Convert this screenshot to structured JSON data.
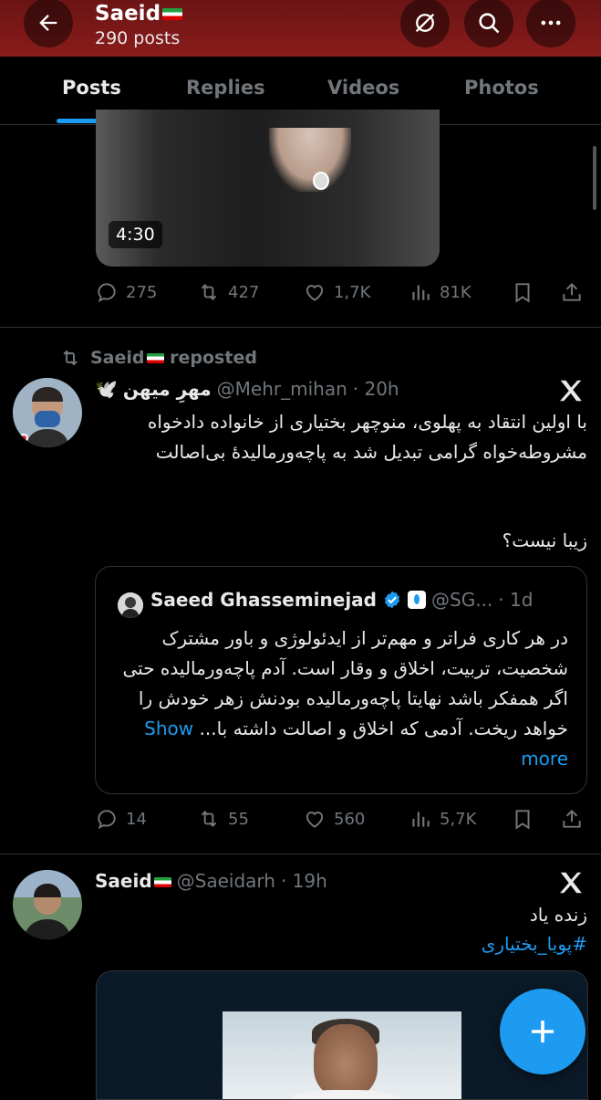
{
  "header": {
    "title": "Saeid",
    "post_count": "290 posts"
  },
  "tabs": [
    "Posts",
    "Replies",
    "Videos",
    "Photos"
  ],
  "post1": {
    "video_duration": "4:30",
    "replies": "275",
    "reposts": "427",
    "likes": "1,7K",
    "views": "81K"
  },
  "post2": {
    "repost_label": "reposted",
    "reposter": "Saeid",
    "author_name": "مهرِ میهن",
    "author_emoji": "🕊️",
    "handle": "@Mehr_mihan",
    "time": "· 20h",
    "text": "با اولین انتقاد به پهلوی، منوچهر بختیاری از خانواده دادخواه مشروطه‌خواه گرامی تبدیل شد به پاچه‌ورمالیدهٔ بی‌اصالت",
    "text2": "زیبا نیست؟",
    "quote": {
      "author_name": "Saeed Ghasseminejad",
      "handle": "@SG...",
      "time": "· 1d",
      "text": "در هر کاری فراتر و مهم‌تر از ایدئولوژی و باور مشترک شخصیت، تربیت، اخلاق و وقار است. آدم پاچه‌ورمالیده حتی اگر همفکر باشد نهایتا پاچه‌ورمالیده بودنش زهر خودش را خواهد ریخت.",
      "text_tail": "آدمی که اخلاق و اصالت داشته با...",
      "show_more": "Show more"
    },
    "replies": "14",
    "reposts": "55",
    "likes": "560",
    "views": "5,7K"
  },
  "post3": {
    "author_name": "Saeid",
    "handle": "@Saeidarh",
    "time": "· 19h",
    "text": "زنده یاد",
    "hashtag": "#پویا_بختیاری"
  },
  "colors": {
    "accent": "#1d9bf0",
    "header_bg": "#8a1c1c",
    "muted": "#71767b"
  }
}
